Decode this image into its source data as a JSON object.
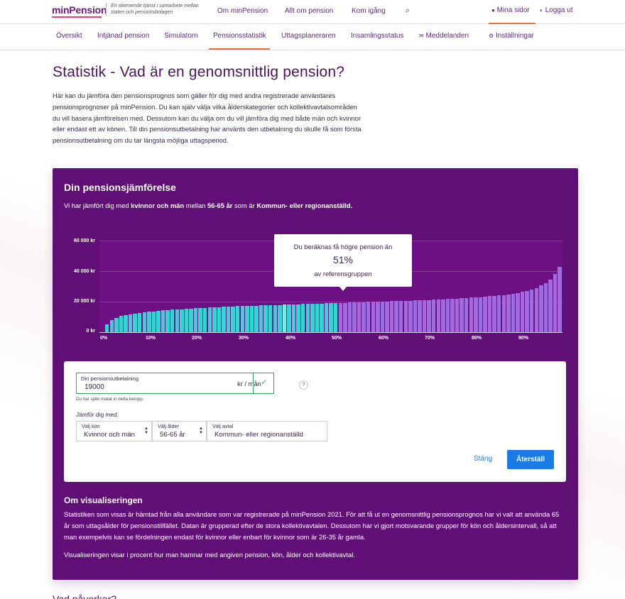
{
  "header": {
    "logo_min": "min",
    "logo_pension": "Pension",
    "tagline": "En oberoende tjänst i samarbete mellan staten och pensionsbolagen",
    "nav": [
      "Om minPension",
      "Allt om pension",
      "Kom igång"
    ],
    "search_icon": "⌕",
    "mina_sidor": "Mina sidor",
    "logga_ut": "Logga ut"
  },
  "subnav": {
    "items": [
      "Översikt",
      "Intjänad pension",
      "Simulatorn",
      "Pensionsstatistik",
      "Uttagsplaneraren",
      "Insamlingsstatus",
      "Meddelanden",
      "Inställningar"
    ],
    "active": "Pensionsstatistik"
  },
  "page": {
    "title": "Statistik - Vad är en genomsnittlig pension?",
    "intro": "Här kan du jämföra den pensionsprognos som gäller för dig med andra registrerade användares pensionsprognoser på minPension. Du kan själv välja vilka ålderskategorier och kollektivavtalsområden du vill basera jämförelsen med. Dessutom kan du välja om du vill jämföra dig med både män och kvinnor eller endast ett av könen. Till din pensionsutbetalning har använts den utbetalning du skulle få som första pensionsutbetalning om du tar längsta möjliga uttagsperiod."
  },
  "card": {
    "title": "Din pensionsjämförelse",
    "sub_pre": "Vi har jämfört dig med ",
    "sub_b1": "kvinnor och män",
    "sub_mid": " mellan ",
    "sub_b2": "56-65 år",
    "sub_mid2": " som är ",
    "sub_b3": "Kommun- eller regionanställd."
  },
  "tooltip": {
    "line1": "Du beräknas få högre pension än",
    "percent": "51%",
    "line3": "av referensgruppen"
  },
  "chart_data": {
    "type": "bar",
    "y_ticks": [
      "60 000 kr",
      "40 000 kr",
      "20 000 kr",
      "0 kr"
    ],
    "x_ticks": [
      "0%",
      "10%",
      "20%",
      "30%",
      "40%",
      "50%",
      "60%",
      "70%",
      "80%",
      "90%"
    ],
    "ylim": [
      0,
      60000
    ],
    "user_percentile": 51,
    "values": [
      5000,
      8000,
      9500,
      10500,
      11200,
      11800,
      12300,
      12700,
      13100,
      13400,
      13700,
      14000,
      14300,
      14500,
      14700,
      14900,
      15100,
      15300,
      15500,
      15700,
      15850,
      16000,
      16150,
      16300,
      16450,
      16600,
      16750,
      16900,
      17000,
      17100,
      17200,
      17300,
      17400,
      17500,
      17600,
      17700,
      17800,
      17900,
      18000,
      18100,
      18200,
      18300,
      18400,
      18500,
      18600,
      18700,
      18800,
      18900,
      19000,
      19100,
      19200,
      19300,
      19400,
      19500,
      19600,
      19700,
      19800,
      19900,
      20000,
      20100,
      20200,
      20300,
      20400,
      20500,
      20600,
      20700,
      20800,
      20900,
      21000,
      21100,
      21250,
      21400,
      21550,
      21700,
      21850,
      22000,
      22200,
      22400,
      22600,
      22800,
      23000,
      23250,
      23500,
      23750,
      24000,
      24400,
      24800,
      25200,
      25700,
      26300,
      27000,
      27800,
      29000,
      30500,
      32000,
      34500,
      38000,
      43000
    ],
    "colors": {
      "below": "#35d3d6",
      "highlight": "#7fe6e8",
      "above": "#a06ae0",
      "plot_bg": "#6d1083"
    }
  },
  "form": {
    "pension_label": "Din pensionsutbetalning",
    "pension_value": "19000",
    "pension_unit": "kr / mån",
    "ok_icon": "✓",
    "help": "?",
    "note": "Du har själv matat in detta belopp.",
    "compare_label": "Jämför dig med:",
    "kon_label": "Välj kön",
    "kon_value": "Kvinnor och män",
    "alder_label": "Välj ålder",
    "alder_value": "56-65 år",
    "avtal_label": "Välj avtal",
    "avtal_value": "Kommun- eller regionanställd",
    "stang": "Stäng",
    "aterstall": "Återställ"
  },
  "about": {
    "title": "Om visualiseringen",
    "p1": "Statistiken som visas är hämtad från alla användare som var registrerade på minPension 2021. För att få ut en genomsnittlig pensionsprognos har vi valt att använda 65 år som uttagsålder för pensionstillfället. Datan är grupperad efter de stora kollektivavtalen. Dessutom har vi gjort motsvarande grupper för kön och åldersintervall, så att man exempelvis kan se fördelningen endast för kvinnor eller enbart för kvinnor som är 26-35 år gamla.",
    "p2": "Visualiseringen visar i procent hur man hamnar med angiven pension, kön, ålder och kollektivavtal."
  },
  "peek_heading": "Vad påverkar?"
}
